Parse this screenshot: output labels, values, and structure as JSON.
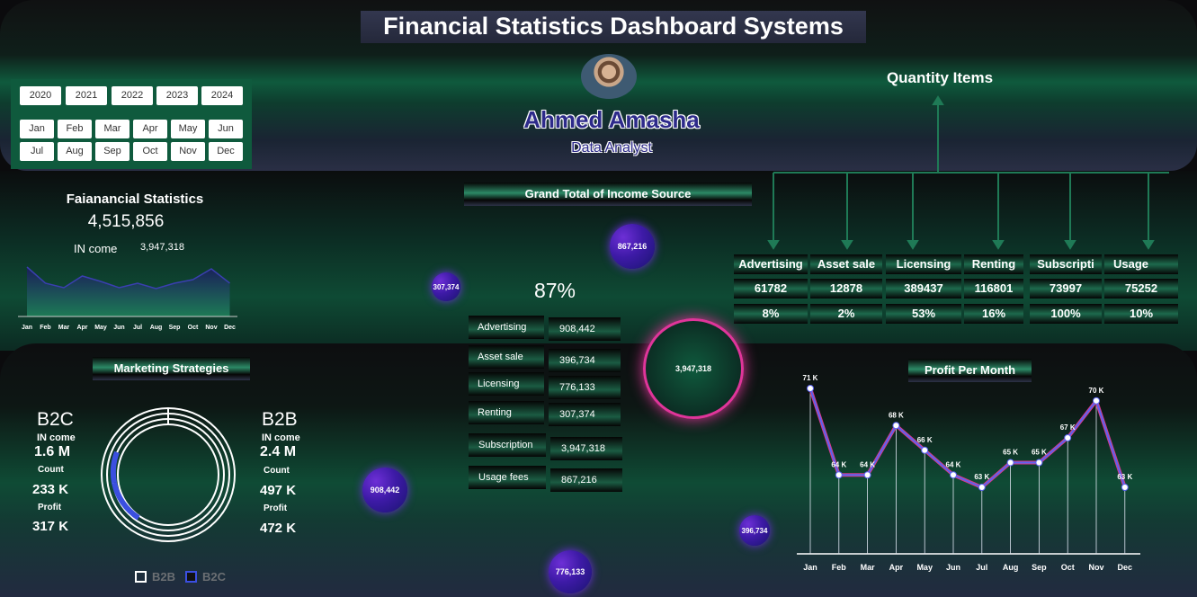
{
  "title": "Financial Statistics Dashboard Systems",
  "years": [
    "2020",
    "2021",
    "2022",
    "2023",
    "2024"
  ],
  "months": [
    "Jan",
    "Feb",
    "Mar",
    "Apr",
    "May",
    "Jun",
    "Jul",
    "Aug",
    "Sep",
    "Oct",
    "Nov",
    "Dec"
  ],
  "profile": {
    "name": "Ahmed Amasha",
    "role": "Data Analyst"
  },
  "quantity": {
    "title": "Quantity Items",
    "items": [
      {
        "label": "Advertising",
        "qty": "61782",
        "pct": "8%"
      },
      {
        "label": "Asset sale",
        "qty": "12878",
        "pct": "2%"
      },
      {
        "label": "Licensing",
        "qty": "389437",
        "pct": "53%"
      },
      {
        "label": "Renting",
        "qty": "116801",
        "pct": "16%"
      },
      {
        "label": "Subscripti",
        "qty": "73997",
        "pct": "100%"
      },
      {
        "label": "Usage",
        "qty": "75252",
        "pct": "10%"
      }
    ]
  },
  "financial": {
    "title": "Faianancial Statistics",
    "total": "4,515,856",
    "income_label": "IN come",
    "income_value": "3,947,318",
    "spark_months": [
      "Jan",
      "Feb",
      "Mar",
      "Apr",
      "May",
      "Jun",
      "Jul",
      "Aug",
      "Sep",
      "Oct",
      "Nov",
      "Dec"
    ]
  },
  "income_source": {
    "title": "Grand Total of Income Source",
    "percent": "87%",
    "rows": [
      {
        "label": "Advertising",
        "value": "908,442"
      },
      {
        "label": "Asset sale",
        "value": "396,734"
      },
      {
        "label": "Licensing",
        "value": "776,133"
      },
      {
        "label": "Renting",
        "value": "307,374"
      },
      {
        "label": "Subscription",
        "value": "3,947,318"
      },
      {
        "label": "Usage fees",
        "value": "867,216"
      }
    ],
    "bubbles": [
      "867,216",
      "307,374",
      "3,947,318",
      "908,442",
      "396,734",
      "776,133"
    ]
  },
  "marketing": {
    "title": "Marketing Strategies",
    "b2c": {
      "heading": "B2C",
      "income_label": "IN come",
      "income": "1.6 M",
      "count_label": "Count",
      "count": "233 K",
      "profit_label": "Profit",
      "profit": "317 K"
    },
    "b2b": {
      "heading": "B2B",
      "income_label": "IN come",
      "income": "2.4 M",
      "count_label": "Count",
      "count": "497 K",
      "profit_label": "Profit",
      "profit": "472 K"
    },
    "legend": [
      "B2B",
      "B2C"
    ]
  },
  "chart_data": {
    "type": "line",
    "title": "Profit Per Month",
    "categories": [
      "Jan",
      "Feb",
      "Mar",
      "Apr",
      "May",
      "Jun",
      "Jul",
      "Aug",
      "Sep",
      "Oct",
      "Nov",
      "Dec"
    ],
    "values": [
      71,
      64,
      64,
      68,
      66,
      64,
      63,
      65,
      65,
      67,
      70,
      63
    ],
    "labels": [
      "71 K",
      "64 K",
      "64 K",
      "68 K",
      "66 K",
      "64 K",
      "63 K",
      "65 K",
      "65 K",
      "67 K",
      "70 K",
      "63 K"
    ],
    "unit": "K",
    "ylim": [
      61,
      72
    ],
    "grid": false
  },
  "colors": {
    "accent_green": "#0f5a3d",
    "line_blue": "#5b63f0",
    "line_pink": "#d43a8a",
    "bubble_purple": "#4b1fb8"
  }
}
